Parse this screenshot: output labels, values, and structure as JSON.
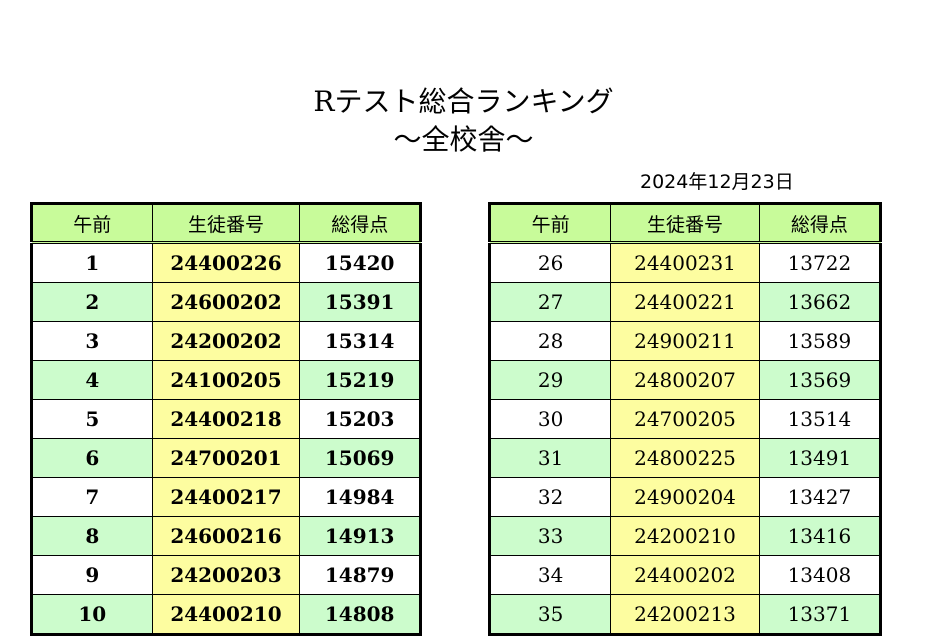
{
  "title": "Rテスト総合ランキング",
  "subtitle": "〜全校舎〜",
  "date": "2024年12月23日",
  "headers": [
    "午前",
    "生徒番号",
    "総得点"
  ],
  "left_table": [
    {
      "rank": "1",
      "id": "24400226",
      "score": "15420"
    },
    {
      "rank": "2",
      "id": "24600202",
      "score": "15391"
    },
    {
      "rank": "3",
      "id": "24200202",
      "score": "15314"
    },
    {
      "rank": "4",
      "id": "24100205",
      "score": "15219"
    },
    {
      "rank": "5",
      "id": "24400218",
      "score": "15203"
    },
    {
      "rank": "6",
      "id": "24700201",
      "score": "15069"
    },
    {
      "rank": "7",
      "id": "24400217",
      "score": "14984"
    },
    {
      "rank": "8",
      "id": "24600216",
      "score": "14913"
    },
    {
      "rank": "9",
      "id": "24200203",
      "score": "14879"
    },
    {
      "rank": "10",
      "id": "24400210",
      "score": "14808"
    }
  ],
  "right_table": [
    {
      "rank": "26",
      "id": "24400231",
      "score": "13722"
    },
    {
      "rank": "27",
      "id": "24400221",
      "score": "13662"
    },
    {
      "rank": "28",
      "id": "24900211",
      "score": "13589"
    },
    {
      "rank": "29",
      "id": "24800207",
      "score": "13569"
    },
    {
      "rank": "30",
      "id": "24700205",
      "score": "13514"
    },
    {
      "rank": "31",
      "id": "24800225",
      "score": "13491"
    },
    {
      "rank": "32",
      "id": "24900204",
      "score": "13427"
    },
    {
      "rank": "33",
      "id": "24200210",
      "score": "13416"
    },
    {
      "rank": "34",
      "id": "24400202",
      "score": "13408"
    },
    {
      "rank": "35",
      "id": "24200213",
      "score": "13371"
    }
  ]
}
